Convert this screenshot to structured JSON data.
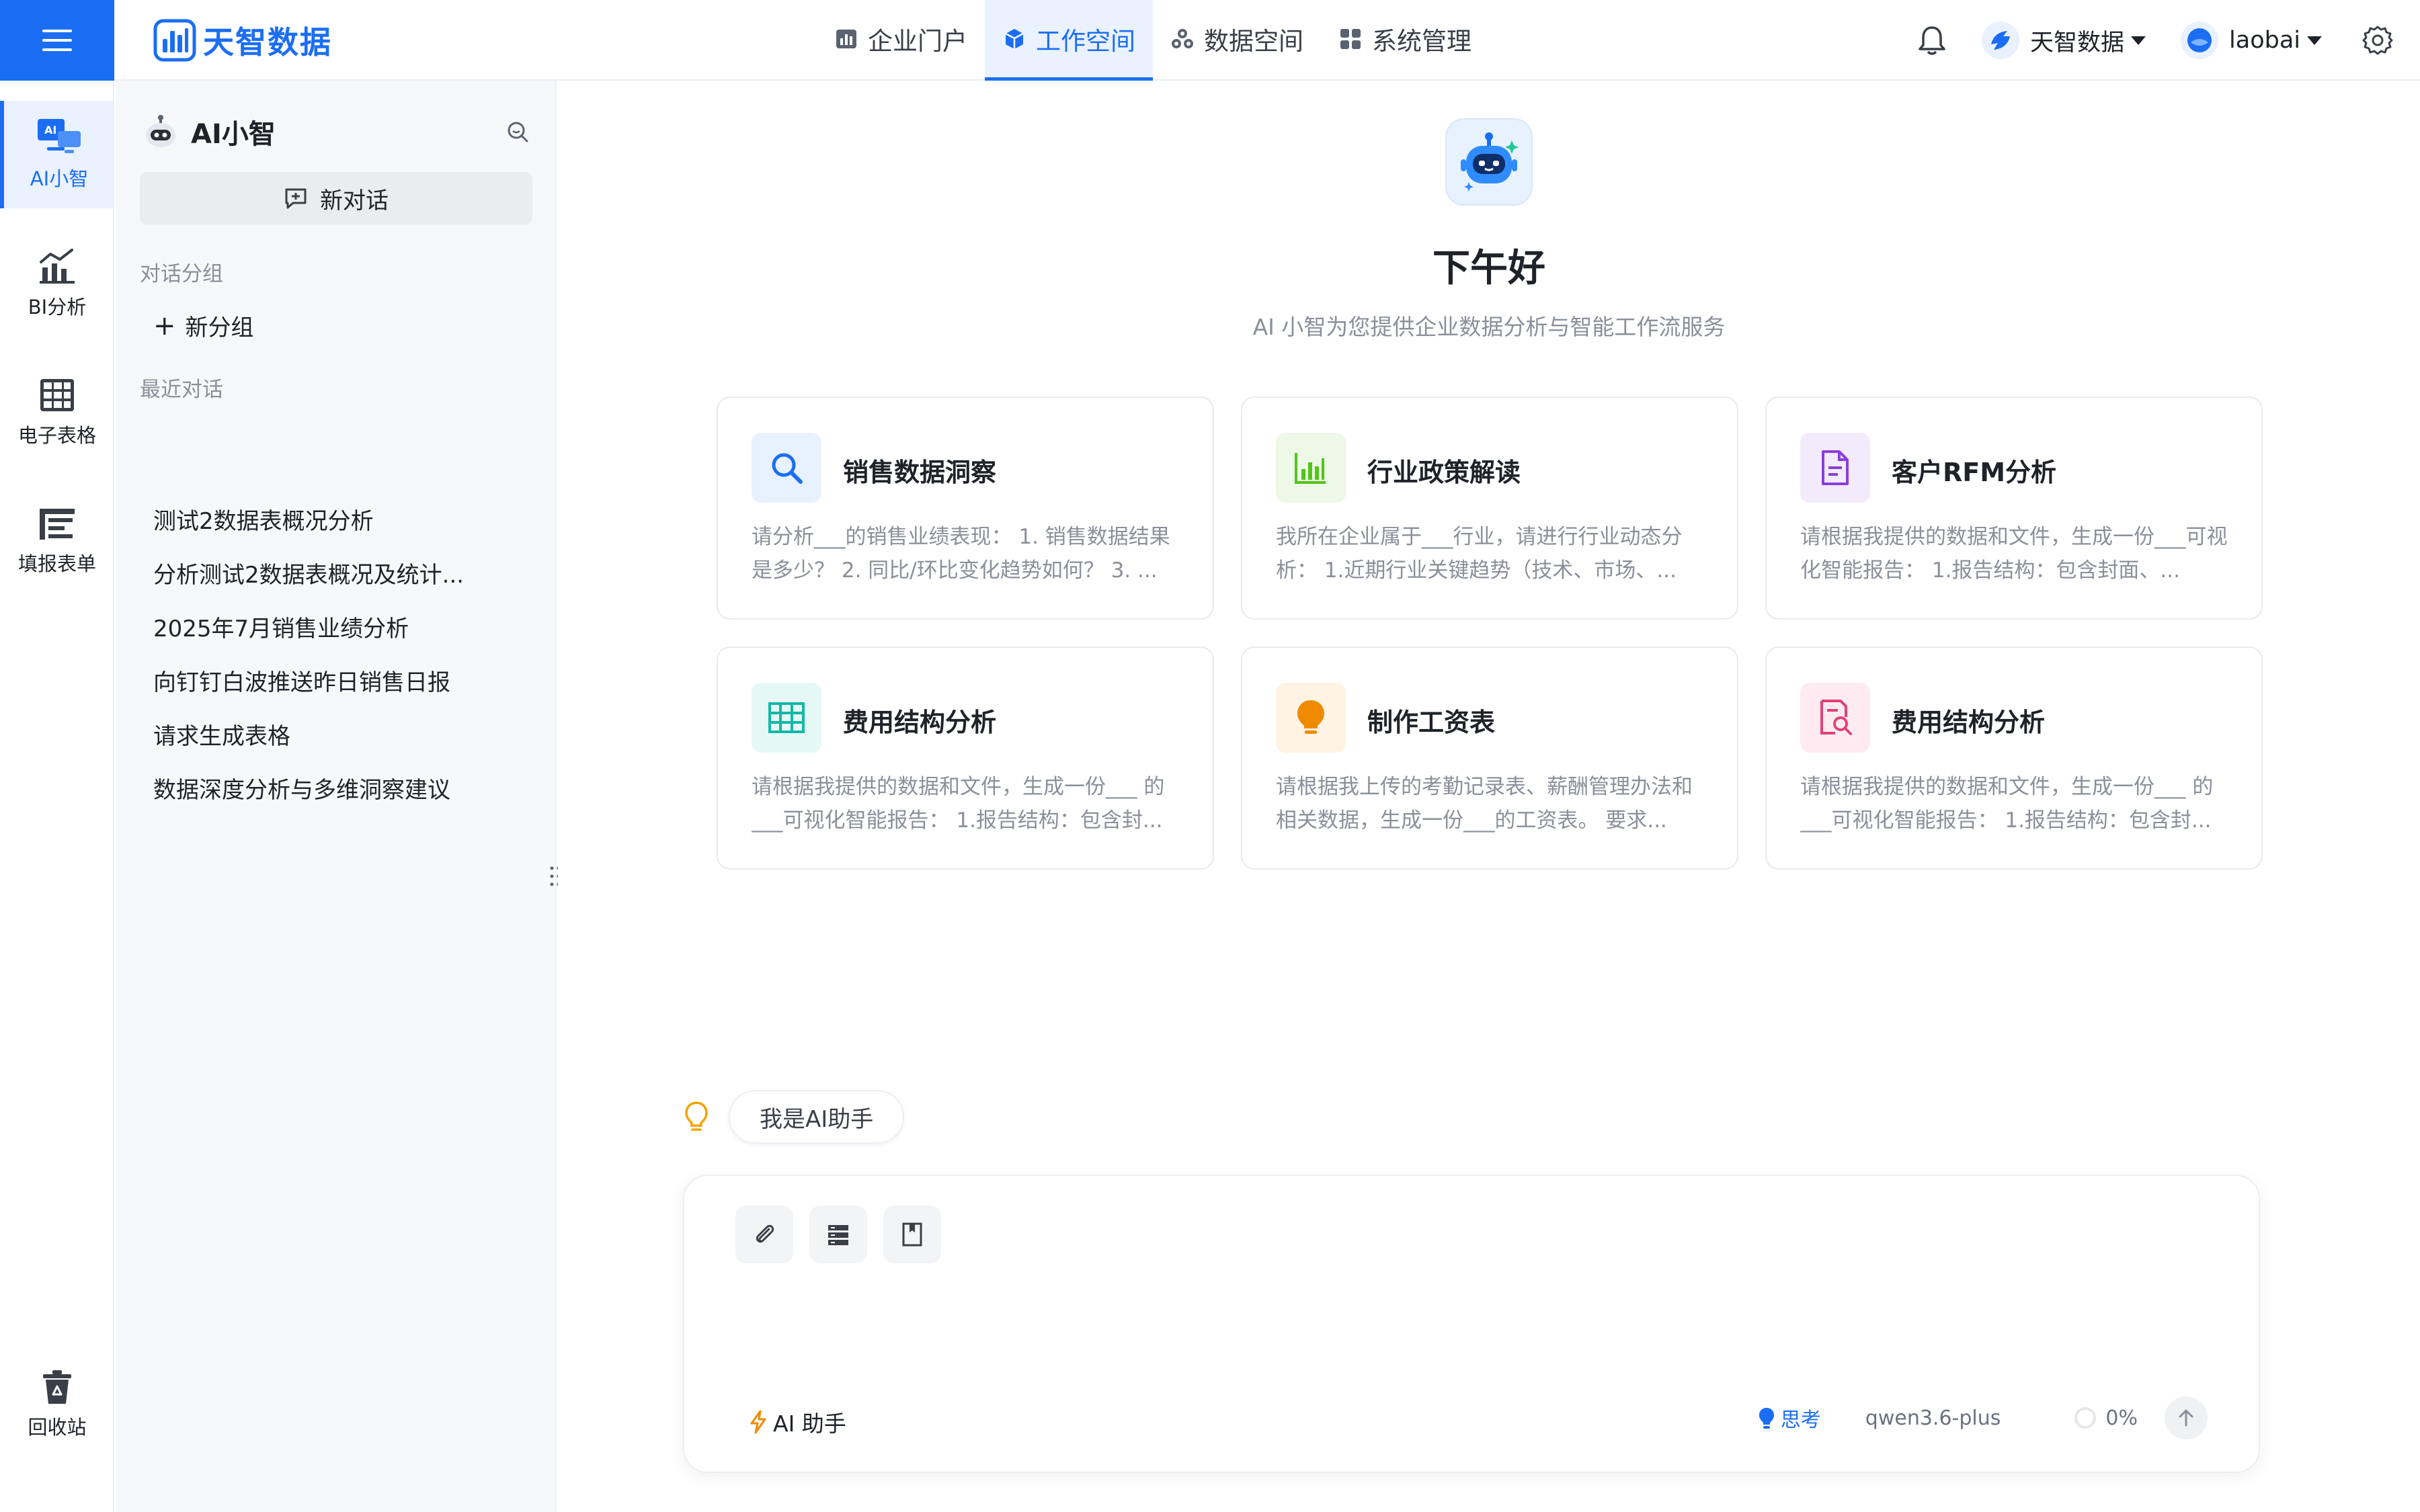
{
  "brand": {
    "name": "天智数据"
  },
  "nav": [
    {
      "label": "企业门户",
      "icon": "chart-icon"
    },
    {
      "label": "工作空间",
      "icon": "cube-icon",
      "active": true
    },
    {
      "label": "数据空间",
      "icon": "cluster-icon"
    },
    {
      "label": "系统管理",
      "icon": "grid-icon"
    }
  ],
  "topbar": {
    "workspace": "天智数据",
    "user": "laobai"
  },
  "rail": [
    {
      "label": "AI小智",
      "icon": "ai-monitor-icon",
      "active": true
    },
    {
      "label": "BI分析",
      "icon": "bar-chart-icon"
    },
    {
      "label": "电子表格",
      "icon": "table-icon"
    },
    {
      "label": "填报表单",
      "icon": "form-icon"
    },
    {
      "label": "回收站",
      "icon": "recycle-bin-icon"
    }
  ],
  "panel": {
    "title": "AI小智",
    "new_chat": "新对话",
    "groups_label": "对话分组",
    "new_group": "新分组",
    "recent_label": "最近对话",
    "recent": [
      "测试2数据表概况分析",
      "分析测试2数据表概况及统计...",
      "2025年7月销售业绩分析",
      "向钉钉白波推送昨日销售日报",
      "请求生成表格",
      "数据深度分析与多维洞察建议"
    ]
  },
  "main": {
    "greeting": "下午好",
    "subtitle": "AI 小智为您提供企业数据分析与智能工作流服务",
    "cards": [
      {
        "title": "销售数据洞察",
        "desc": "请分析___的销售业绩表现： 1. 销售数据结果是多少？ 2. 同比/环比变化趋势如何？ 3. ...",
        "icon": "search-icon",
        "color": "#1b6ef3",
        "bg": "#e8f1ff"
      },
      {
        "title": "行业政策解读",
        "desc": "我所在企业属于___行业，请进行行业动态分析： 1.近期行业关键趋势（技术、市场、...",
        "icon": "bar-chart-icon",
        "color": "#52c41a",
        "bg": "#edf8e6"
      },
      {
        "title": "客户RFM分析",
        "desc": "请根据我提供的数据和文件，生成一份___可视化智能报告： 1.报告结构：包含封面、...",
        "icon": "document-icon",
        "color": "#8b3fd9",
        "bg": "#f3ebfc"
      },
      {
        "title": "费用结构分析",
        "desc": "请根据我提供的数据和文件，生成一份___ 的___可视化智能报告： 1.报告结构：包含封...",
        "icon": "table-icon",
        "color": "#13b8a6",
        "bg": "#e6f8f5"
      },
      {
        "title": "制作工资表",
        "desc": "请根据我上传的考勤记录表、薪酬管理办法和相关数据，生成一份___的工资表。 要求...",
        "icon": "lightbulb-icon",
        "color": "#f08a00",
        "bg": "#fff3e3"
      },
      {
        "title": "费用结构分析",
        "desc": "请根据我提供的数据和文件，生成一份___ 的___可视化智能报告： 1.报告结构：包含封...",
        "icon": "doc-search-icon",
        "color": "#e0427a",
        "bg": "#fdebf1"
      }
    ],
    "hint": "我是AI助手",
    "assistant_tag": "AI 助手",
    "think": "思考",
    "model": "qwen3.6-plus",
    "progress": "0%"
  }
}
